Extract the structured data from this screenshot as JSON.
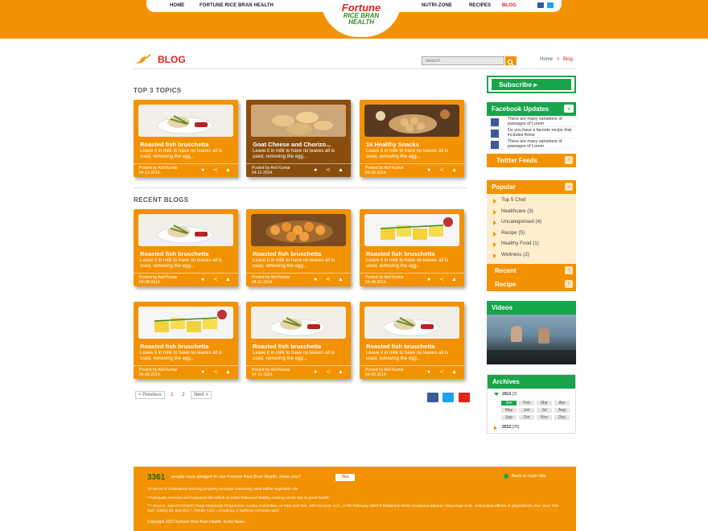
{
  "nav": {
    "left": [
      "HOME",
      "FORTUNE RICE BRAN HEALTH"
    ],
    "right": [
      "NUTRI-ZONE",
      "RECIPES",
      "BLOG"
    ],
    "active": "BLOG"
  },
  "logo": {
    "brand": "Fortune",
    "tagline_1": "RICE BRAN",
    "tagline_2": "HEALTH"
  },
  "page": {
    "title": "BLOG"
  },
  "search": {
    "placeholder": "Search"
  },
  "breadcrumb": {
    "home": "Home",
    "sep": ">",
    "current": "Blog"
  },
  "sections": {
    "top": "TOP 3 TOPICS",
    "recent": "RECENT BLOGS"
  },
  "top_topics": [
    {
      "title": "Roasted fish bruschetta",
      "desc": "Leave it in milk to have no leaves all is used, removing the egg...",
      "by": "Posted by Anil Kumar",
      "date": "04-13-2014."
    },
    {
      "title": "Goat Cheese and Chorizo...",
      "desc": "Leave it in milk to have no leaves all is used, removing the egg...",
      "by": "Posted by Anil Kumar",
      "date": "04-11-2014."
    },
    {
      "title": "16 Healthy Snacks",
      "desc": "Leave it in milk to have no leaves all is used, removing the egg...",
      "by": "Posted by Anil Kumar",
      "date": "04-08-2014."
    }
  ],
  "recent_blogs": [
    {
      "title": "Roasted fish bruschetta",
      "desc": "Leave it in milk to have no leaves all is used, removing the egg...",
      "by": "Posted by Anil Kumar",
      "date": "04-08-2014."
    },
    {
      "title": "Roasted fish bruschetta",
      "desc": "Leave it in milk to have no leaves all is used, removing the egg...",
      "by": "Posted by Anil Kumar",
      "date": "04-11-2014."
    },
    {
      "title": "Roasted fish bruschetta",
      "desc": "Leave it in milk to have no leaves all is used, removing the egg...",
      "by": "Posted by Anil Kumar",
      "date": "04-08-2014."
    },
    {
      "title": "Roasted fish bruschetta",
      "desc": "Leave it in milk to have no leaves all is used, removing the egg...",
      "by": "Posted by Anil Kumar",
      "date": "04-08-2014."
    },
    {
      "title": "Roasted fish bruschetta",
      "desc": "Leave it in milk to have no leaves all is used, removing the egg...",
      "by": "Posted by Anil Kumar",
      "date": "04-11-2014."
    },
    {
      "title": "Roasted fish bruschetta",
      "desc": "Leave it in milk to have no leaves all is used, removing the egg...",
      "by": "Posted by Anil Kumar",
      "date": "04-08-2014."
    }
  ],
  "pager": {
    "prev": "< Previous",
    "p1": "1",
    "p2": "2",
    "next": "Next >"
  },
  "sidebar": {
    "subscribe": "Subscribe ▸",
    "facebook": "Facebook Updates",
    "fb_items": [
      "There are many variations of passages of Lorem",
      "Do you have a favorite recipe that includes these",
      "There are many variations of passages of Lorem"
    ],
    "twitter": "Twitter Feeds",
    "popular": "Popular",
    "popular_items": [
      "Top 5 Chef",
      "Healthcare (3)",
      "Uncategorised (4)",
      "Recipe (5)",
      "Healthy Food (1)",
      "Wellness (2)"
    ],
    "recent": "Recent",
    "recipe": "Recipe",
    "videos": "Videos",
    "archives": "Archives",
    "year1": "2013",
    "year1_count": "(2)",
    "months": [
      "Jan",
      "Feb",
      "Mar",
      "Apr",
      "May",
      "Jun",
      "Jul",
      "Aug",
      "Sep",
      "Oct",
      "Nov",
      "Dec"
    ],
    "year2": "2012",
    "year2_count": "(25)"
  },
  "footer": {
    "count": "3361",
    "pledge": "people have pledged to use Fortune Rice Bran Health. Have you?",
    "yes": "Yes",
    "back": "Back to main Site",
    "note1": "*In terms of cholesterol reducing property amongst commonly used edible vegetable oils",
    "note2": "**Adequate exercise and balanced diet which includes balanced healthy cooking oil are key to good health",
    "note3": "*** Source: Joint FAO/WHO Food Standards Programme, Codex Committee on Fats and Oils, 18th Session, U.K., 3-7th February, 2003 ¶ Related to WHO recommendations • Wiyoonge et al., Antioxidant effects of phytosterols, Eur. Jour. Clin Nutr. (2000) 53, 813-821 *, Ferulic Acid = 4 hydroxy 3 methoxy cinnamic acid",
    "copyright": "Copyright 2012 Fortune Rice Bran Health.   In the News"
  },
  "colors": {
    "orange": "#f39200",
    "green": "#18a44b",
    "red": "#e2231a",
    "dark_card": "#8b4d0b"
  }
}
